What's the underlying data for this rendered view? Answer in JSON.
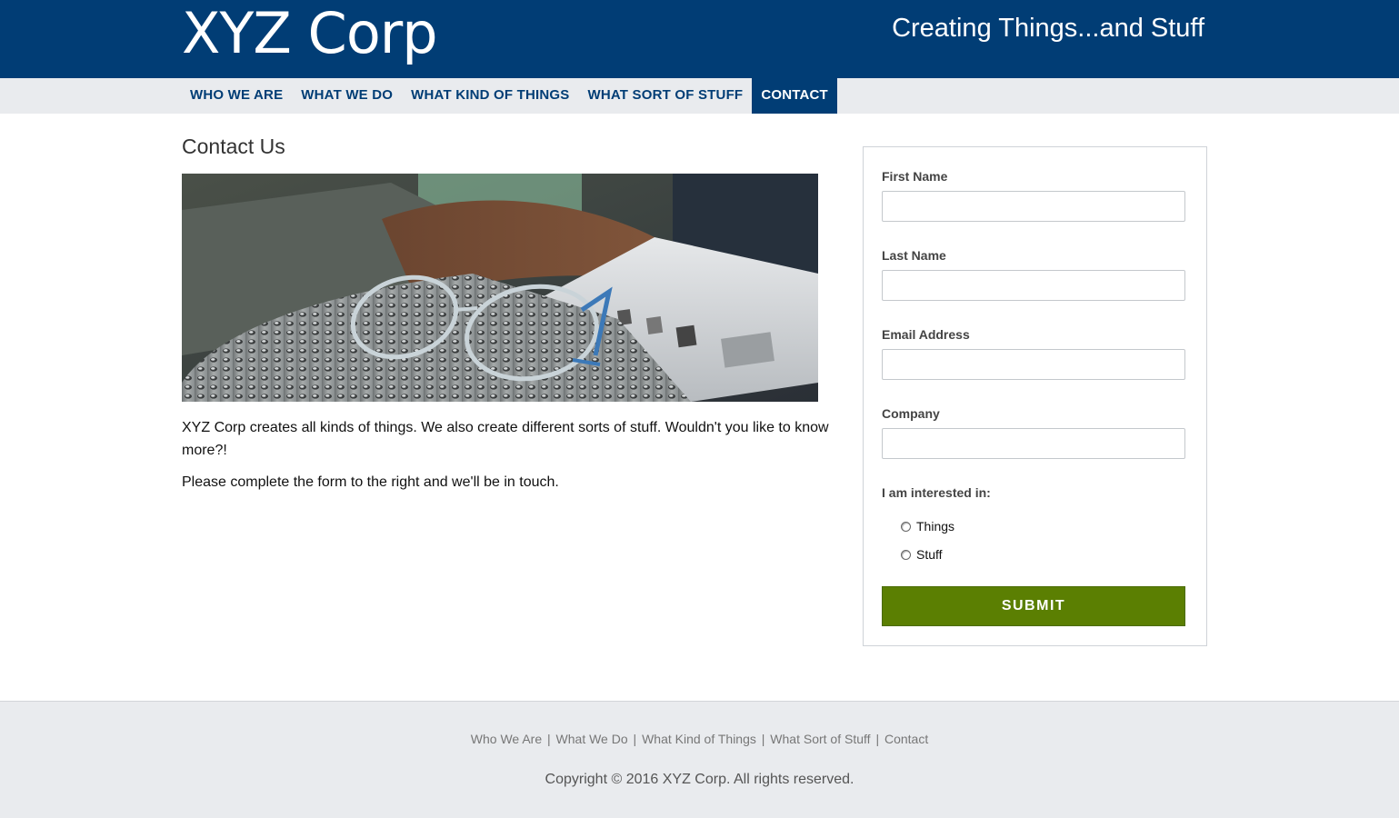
{
  "header": {
    "logo": "XYZ Corp",
    "tagline": "Creating Things...and Stuff"
  },
  "nav": {
    "items": [
      {
        "label": "WHO WE ARE"
      },
      {
        "label": "WHAT WE DO"
      },
      {
        "label": "WHAT KIND OF THINGS"
      },
      {
        "label": "WHAT SORT OF STUFF"
      },
      {
        "label": "CONTACT",
        "active": true
      }
    ]
  },
  "main": {
    "title": "Contact Us",
    "image_alt_icon": "photo-glasses-laptop",
    "intro": "XYZ Corp creates all kinds of things. We also create different sorts of stuff. Wouldn't you like to know more?!",
    "instructions": "Please complete the form to the right and we'll be in touch."
  },
  "form": {
    "first_name_label": "First Name",
    "first_name_value": "",
    "last_name_label": "Last Name",
    "last_name_value": "",
    "email_label": "Email Address",
    "email_value": "",
    "company_label": "Company",
    "company_value": "",
    "interest_label": "I am interested in:",
    "options": [
      "Things",
      "Stuff"
    ],
    "submit_label": "SUBMIT"
  },
  "footer": {
    "links": [
      "Who We Are",
      "What We Do",
      "What Kind of Things",
      "What Sort of Stuff",
      "Contact"
    ],
    "separator": "|",
    "copyright": "Copyright © 2016 XYZ Corp. All rights reserved."
  },
  "colors": {
    "brand_navy": "#013d75",
    "nav_bg": "#e9ebee",
    "submit_green": "#5b7f02"
  }
}
